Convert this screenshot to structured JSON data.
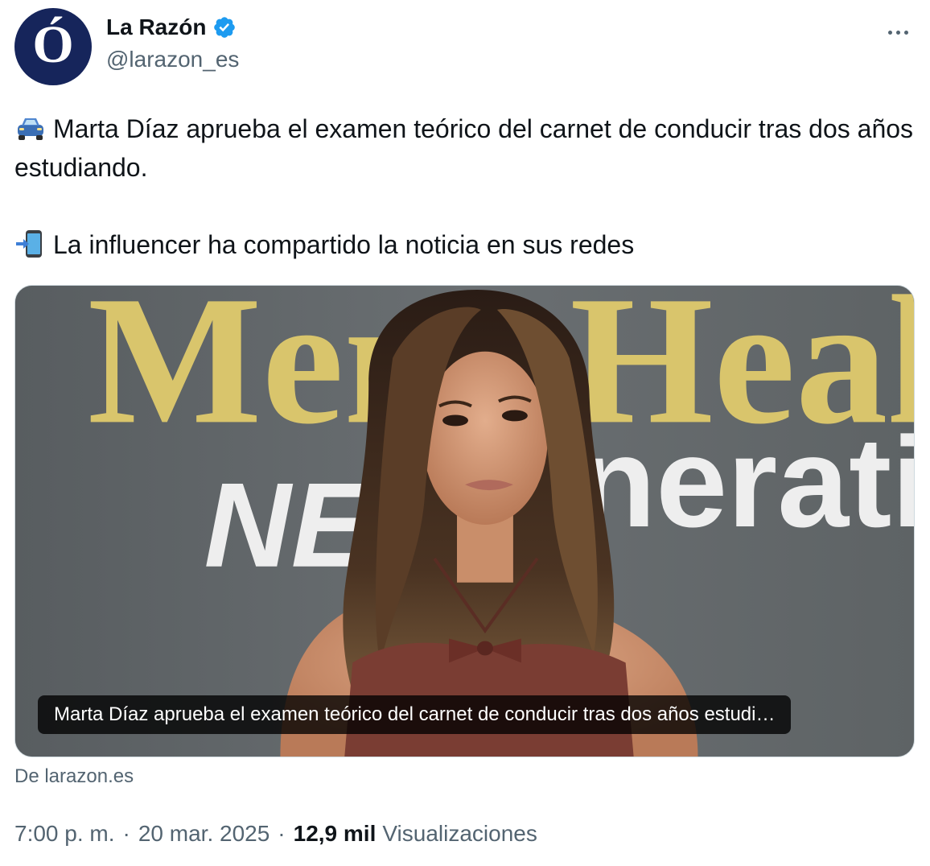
{
  "account": {
    "display_name": "La Razón",
    "handle": "@larazon_es",
    "avatar_letter": "Ó",
    "verified": true,
    "avatar_bg": "#16255b",
    "verified_color": "#1d9bf0"
  },
  "tweet": {
    "line1_emoji": "car-icon",
    "line1": "Marta Díaz aprueba el examen teórico del carnet de conducir tras dos años estudiando.",
    "line2_emoji": "phone-arrow-icon",
    "line2": "La influencer ha compartido la noticia en sus redes"
  },
  "card": {
    "caption": "Marta Díaz aprueba el examen teórico del carnet de conducir tras dos años estudi…",
    "source": "De larazon.es",
    "backdrop_text_top": "Men'sHeal",
    "backdrop_text_bottom": "NEX",
    "backdrop_text_bottom_right": "neratio"
  },
  "meta": {
    "time": "7:00 p. m.",
    "date": "20 mar. 2025",
    "separator": "·",
    "views_count": "12,9 mil",
    "views_label": "Visualizaciones"
  }
}
